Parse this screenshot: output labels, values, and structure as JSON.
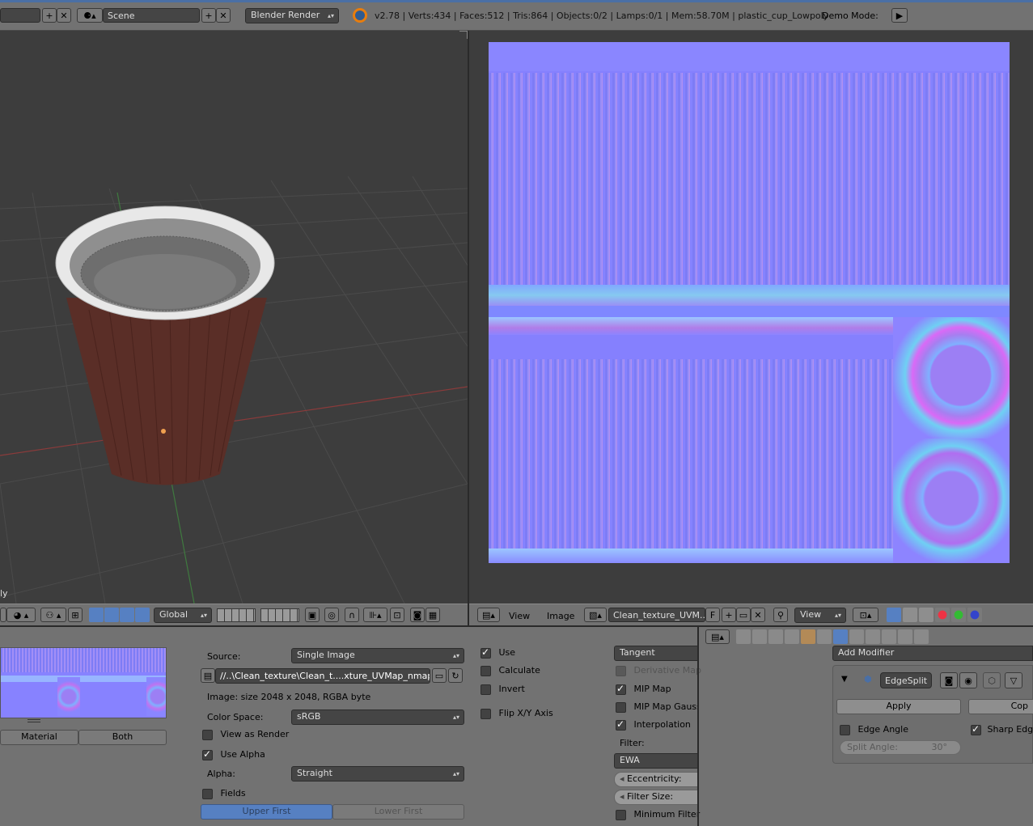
{
  "top": {
    "scene_name": "Scene",
    "render_engine": "Blender Render",
    "stats": "v2.78 | Verts:434 | Faces:512 | Tris:864 | Objects:0/2 | Lamps:0/1 | Mem:58.70M | plastic_cup_Lowpoly",
    "demo_mode_label": "Demo Mode:"
  },
  "viewport3d": {
    "object_label": "ly",
    "orientation": "Global"
  },
  "image_editor": {
    "menu_view": "View",
    "menu_image": "Image",
    "image_name": "Clean_texture_UVM...",
    "fake_user": "F",
    "view_mode": "View"
  },
  "texture_panel": {
    "material_tab": "Material",
    "both_tab": "Both",
    "source_label": "Source:",
    "source_value": "Single Image",
    "filepath": "//..\\Clean_texture\\Clean_t....xture_UVMap_nmap.png",
    "image_info": "Image: size 2048 x 2048, RGBA byte",
    "color_space_label": "Color Space:",
    "color_space_value": "sRGB",
    "view_as_render": "View as Render",
    "use_alpha": "Use Alpha",
    "alpha_label": "Alpha:",
    "alpha_value": "Straight",
    "fields": "Fields",
    "upper_first": "Upper First",
    "lower_first": "Lower First",
    "use": "Use",
    "calculate": "Calculate",
    "invert": "Invert",
    "flip_xy": "Flip X/Y Axis",
    "tangent": "Tangent",
    "derivative_map": "Derivative Map",
    "mip_map": "MIP Map",
    "mip_map_gauss": "MIP Map Gaussi",
    "interpolation": "Interpolation",
    "filter_label": "Filter:",
    "filter_value": "EWA",
    "eccentricity": "Eccentricity:",
    "filter_size": "Filter Size:",
    "minimum_filter": "Minimum Filter"
  },
  "modifier_panel": {
    "add_modifier": "Add Modifier",
    "modifier_name": "EdgeSplit",
    "apply": "Apply",
    "copy": "Cop",
    "edge_angle": "Edge Angle",
    "sharp_edges": "Sharp Edge",
    "split_angle_label": "Split Angle:",
    "split_angle_value": "30°"
  },
  "colors": {
    "viewport_bg": "#3d3d3d",
    "panel_bg": "#727272",
    "normal_map": "#8080ff",
    "cup_body": "#5a2e27",
    "accent_blue": "#5680c2"
  }
}
